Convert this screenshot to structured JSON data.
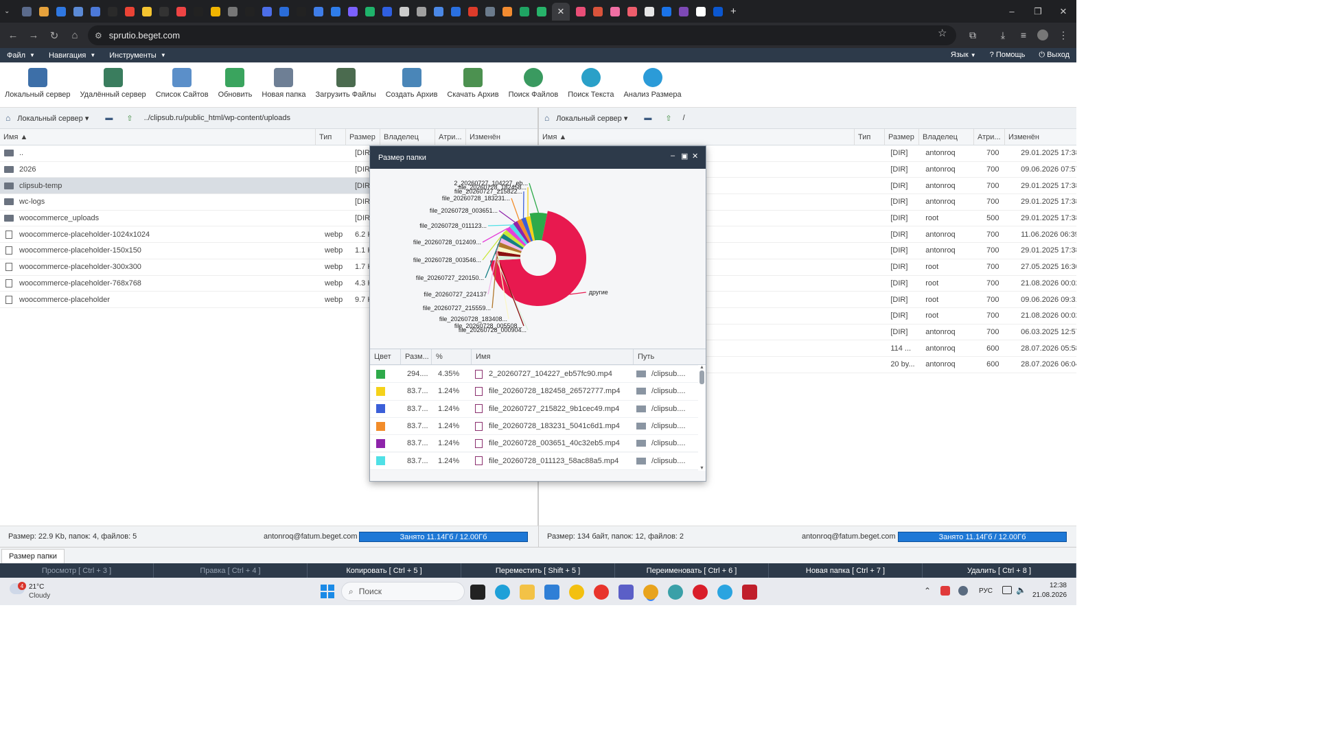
{
  "browser": {
    "url": "sprutio.beget.com",
    "active_tab_close": "✕",
    "new_tab": "+",
    "tab_icon_colors": [
      "#5b6b8c",
      "#e6a23c",
      "#2f78e2",
      "#5b8ad6",
      "#4c79d8",
      "#2a2a2a",
      "#ea4335",
      "#f4c430",
      "#333",
      "#e44",
      "#222",
      "#f0b400",
      "#777",
      "#222",
      "#4c6ee8",
      "#2a6cd8",
      "#222",
      "#3f7de8",
      "#2f7de9",
      "#7b61ff",
      "#1fb36b",
      "#2f5fe0",
      "#cccccc",
      "#a0a0a0",
      "#4b88e6",
      "#2a70e0",
      "#dd3b2a",
      "#6b7b8c",
      "#f28b30",
      "#1fa463",
      "#27b36a",
      "#e94e77",
      "#d9533b",
      "#f06fa4",
      "#ee5d6c",
      "#e6e6e6",
      "#1a73e8",
      "#7d49b5",
      "#ffffff",
      "#0b57d0"
    ],
    "window_controls": [
      "–",
      "❐",
      "✕"
    ]
  },
  "menubar": {
    "items": [
      {
        "label": "Файл"
      },
      {
        "label": "Навигация"
      },
      {
        "label": "Инструменты"
      }
    ],
    "right": [
      {
        "label": "Язык"
      },
      {
        "label": "Помощь"
      },
      {
        "label": "Выход"
      }
    ]
  },
  "toolbar": {
    "buttons": [
      {
        "label": "Локальный сервер",
        "icon": "house-icon"
      },
      {
        "label": "Удалённый сервер",
        "icon": "remote-server-icon"
      },
      {
        "label": "Список Сайтов",
        "icon": "sites-list-icon"
      },
      {
        "label": "Обновить",
        "icon": "refresh-icon"
      },
      {
        "label": "Новая папка",
        "icon": "new-folder-icon"
      },
      {
        "label": "Загрузить Файлы",
        "icon": "upload-icon"
      },
      {
        "label": "Создать Архив",
        "icon": "archive-icon"
      },
      {
        "label": "Скачать Архив",
        "icon": "download-archive-icon"
      },
      {
        "label": "Поиск Файлов",
        "icon": "search-files-icon"
      },
      {
        "label": "Поиск Текста",
        "icon": "search-text-icon"
      },
      {
        "label": "Анализ Размера",
        "icon": "size-analysis-icon"
      }
    ]
  },
  "left_pane": {
    "server": "Локальный сервер",
    "path": "../clipsub.ru/public_html/wp-content/uploads",
    "columns": {
      "name": "Имя",
      "type": "Тип",
      "size": "Размер",
      "owner": "Владелец",
      "attr": "Атри...",
      "modified": "Изменён"
    },
    "rows": [
      {
        "name": "..",
        "kind": "dir",
        "type": "",
        "size": "[DIR]"
      },
      {
        "name": "2026",
        "kind": "dir",
        "type": "",
        "size": "[DIR]"
      },
      {
        "name": "clipsub-temp",
        "kind": "dir",
        "type": "",
        "size": "[DIR]",
        "selected": true
      },
      {
        "name": "wc-logs",
        "kind": "dir",
        "type": "",
        "size": "[DIR]"
      },
      {
        "name": "woocommerce_uploads",
        "kind": "dir",
        "type": "",
        "size": "[DIR]"
      },
      {
        "name": "woocommerce-placeholder-1024x1024",
        "kind": "file",
        "type": "webp",
        "size": "6.2 Kl"
      },
      {
        "name": "woocommerce-placeholder-150x150",
        "kind": "file",
        "type": "webp",
        "size": "1.1 Kl"
      },
      {
        "name": "woocommerce-placeholder-300x300",
        "kind": "file",
        "type": "webp",
        "size": "1.7 Kl"
      },
      {
        "name": "woocommerce-placeholder-768x768",
        "kind": "file",
        "type": "webp",
        "size": "4.3 Kl"
      },
      {
        "name": "woocommerce-placeholder",
        "kind": "file",
        "type": "webp",
        "size": "9.7 Kl"
      }
    ],
    "status": "Размер: 22.9 Kb, папок: 4, файлов: 5",
    "user": "antonroq@fatum.beget.com",
    "quota": "Занято 11.14Гб / 12.00Гб"
  },
  "right_pane": {
    "server": "Локальный сервер",
    "path": "/",
    "columns": {
      "name": "Имя",
      "type": "Тип",
      "size": "Размер",
      "owner": "Владелец",
      "attr": "Атри...",
      "modified": "Изменён"
    },
    "rows": [
      {
        "size": "[DIR]",
        "owner": "antonroq",
        "attr": "700",
        "modified": "29.01.2025 17:38..."
      },
      {
        "size": "[DIR]",
        "owner": "antonroq",
        "attr": "700",
        "modified": "09.06.2026 07:57..."
      },
      {
        "size": "[DIR]",
        "owner": "antonroq",
        "attr": "700",
        "modified": "29.01.2025 17:38..."
      },
      {
        "size": "[DIR]",
        "owner": "antonroq",
        "attr": "700",
        "modified": "29.01.2025 17:38..."
      },
      {
        "size": "[DIR]",
        "owner": "root",
        "attr": "500",
        "modified": "29.01.2025 17:38..."
      },
      {
        "size": "[DIR]",
        "owner": "antonroq",
        "attr": "700",
        "modified": "11.06.2026 06:39..."
      },
      {
        "size": "[DIR]",
        "owner": "antonroq",
        "attr": "700",
        "modified": "29.01.2025 17:38..."
      },
      {
        "size": "[DIR]",
        "owner": "root",
        "attr": "700",
        "modified": "27.05.2025 16:30..."
      },
      {
        "size": "[DIR]",
        "owner": "root",
        "attr": "700",
        "modified": "21.08.2026 00:02..."
      },
      {
        "size": "[DIR]",
        "owner": "root",
        "attr": "700",
        "modified": "09.06.2026 09:31..."
      },
      {
        "size": "[DIR]",
        "owner": "root",
        "attr": "700",
        "modified": "21.08.2026 00:02..."
      },
      {
        "size": "[DIR]",
        "owner": "antonroq",
        "attr": "700",
        "modified": "06.03.2025 12:57..."
      },
      {
        "size": "114 ...",
        "owner": "antonroq",
        "attr": "600",
        "modified": "28.07.2026 05:58..."
      },
      {
        "size": "20 by...",
        "owner": "antonroq",
        "attr": "600",
        "modified": "28.07.2026 06:04..."
      }
    ],
    "status": "Размер: 134 байт, папок: 12, файлов: 2",
    "user": "antonroq@fatum.beget.com",
    "quota": "Занято 11.14Гб / 12.00Гб"
  },
  "bottom_tab": "Размер папки",
  "fn_keys": [
    {
      "label": "Просмотр [ Ctrl + 3 ]",
      "dim": true
    },
    {
      "label": "Правка [ Ctrl + 4 ]",
      "dim": true
    },
    {
      "label": "Копировать [ Ctrl + 5 ]",
      "dim": false
    },
    {
      "label": "Переместить [ Shift + 5 ]",
      "dim": false
    },
    {
      "label": "Переименовать [ Ctrl + 6 ]",
      "dim": false
    },
    {
      "label": "Новая папка [ Ctrl + 7 ]",
      "dim": false
    },
    {
      "label": "Удалить [ Ctrl + 8 ]",
      "dim": false
    }
  ],
  "dialog": {
    "title": "Размер папки",
    "chart_labels": [
      "2_20260727_104227_eb...",
      "file_20260728_182458...",
      "file_20260727_215822...",
      "file_20260728_183231...",
      "file_20260728_003651...",
      "file_20260728_011123...",
      "file_20260728_012409...",
      "file_20260728_003546...",
      "file_20260727_220150...",
      "file_20260727_224137",
      "file_20260727_215559...",
      "file_20260728_183408...",
      "file_20260728_005508...",
      "file_20260728_000904...",
      "другие"
    ],
    "legend_columns": {
      "color": "Цвет",
      "size": "Разм...",
      "pct": "%",
      "name": "Имя",
      "path": "Путь"
    },
    "legend_rows": [
      {
        "color": "#2eaa4a",
        "size": "294....",
        "pct": "4.35%",
        "name": "2_20260727_104227_eb57fc90.mp4",
        "path": "/clipsub...."
      },
      {
        "color": "#f5d21a",
        "size": "83.7...",
        "pct": "1.24%",
        "name": "file_20260728_182458_26572777.mp4",
        "path": "/clipsub...."
      },
      {
        "color": "#3b5fd8",
        "size": "83.7...",
        "pct": "1.24%",
        "name": "file_20260727_215822_9b1cec49.mp4",
        "path": "/clipsub...."
      },
      {
        "color": "#f28c2a",
        "size": "83.7...",
        "pct": "1.24%",
        "name": "file_20260728_183231_5041c6d1.mp4",
        "path": "/clipsub...."
      },
      {
        "color": "#8e24aa",
        "size": "83.7...",
        "pct": "1.24%",
        "name": "file_20260728_003651_40c32eb5.mp4",
        "path": "/clipsub...."
      },
      {
        "color": "#4fe0e6",
        "size": "83.7...",
        "pct": "1.24%",
        "name": "file_20260728_011123_58ac88a5.mp4",
        "path": "/clipsub...."
      }
    ]
  },
  "chart_data": {
    "type": "pie",
    "title": "",
    "labels": [
      "2_20260727_104227_eb...",
      "file_20260728_182458...",
      "file_20260727_215822...",
      "file_20260728_183231...",
      "file_20260728_003651...",
      "file_20260728_011123...",
      "file_20260728_012409...",
      "file_20260728_003546...",
      "file_20260727_220150...",
      "file_20260727_224137",
      "file_20260727_215559...",
      "file_20260728_183408...",
      "file_20260728_005508...",
      "file_20260728_000904...",
      "другие"
    ],
    "values": [
      4.35,
      1.24,
      1.24,
      1.24,
      1.24,
      1.24,
      1.24,
      1.24,
      1.24,
      1.24,
      1.24,
      1.24,
      1.24,
      1.24,
      50
    ],
    "colors": [
      "#2eaa4a",
      "#f5d21a",
      "#3b5fd8",
      "#f28c2a",
      "#8e24aa",
      "#4fe0e6",
      "#e542d8",
      "#c9e83a",
      "#157f84",
      "#f0b6e8",
      "#b0762a",
      "#fbf7c8",
      "#8b1010",
      "#d8f0dc",
      "#e8194f"
    ],
    "donut": true
  },
  "taskbar": {
    "weather_temp": "21°C",
    "weather_desc": "Cloudy",
    "weather_badge": "4",
    "search_placeholder": "Поиск",
    "lang": "РУС",
    "time": "12:38",
    "date": "21.08.2026"
  }
}
